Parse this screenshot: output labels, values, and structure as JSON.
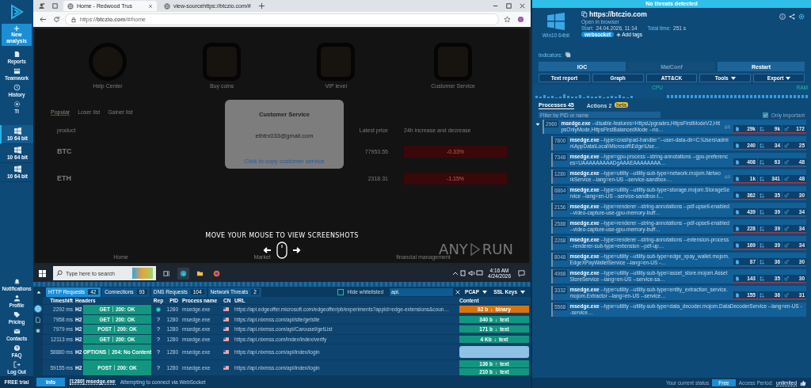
{
  "sidebar": {
    "new_analysis": "New analysis",
    "nav_top": [
      {
        "label": "Reports"
      },
      {
        "label": "Teamwork"
      },
      {
        "label": "History"
      },
      {
        "label": "TI"
      }
    ],
    "vms": [
      {
        "label": "10 64 bit",
        "selected": true
      },
      {
        "label": "10 64 bit",
        "selected": false
      },
      {
        "label": "10 64 bit",
        "selected": false
      }
    ],
    "nav_bottom": [
      {
        "label": "Notifications"
      },
      {
        "label": "Profile"
      },
      {
        "label": "Pricing"
      },
      {
        "label": "Contacts"
      },
      {
        "label": "FAQ"
      },
      {
        "label": "Log Out"
      }
    ],
    "trial_badge": "FREE trial"
  },
  "browser": {
    "tabs": [
      {
        "title": "Home - Redwood Trus",
        "selected": true
      },
      {
        "title": "view-sourcehttps://btczio.com/#",
        "selected": false
      }
    ],
    "address": "https://**btczio.com**/#/home"
  },
  "web": {
    "features": [
      "Help Center",
      "Buy coins",
      "VIP level",
      "Customer Service"
    ],
    "list_tabs": [
      {
        "label": "Popular",
        "selected": true
      },
      {
        "label": "Loser list",
        "selected": false
      },
      {
        "label": "Gainer list",
        "selected": false
      }
    ],
    "columns": [
      "product",
      "Latest price",
      "24h increase and decrease"
    ],
    "rows": [
      {
        "symbol": "BTC",
        "price": "77953.55",
        "change": "-0.33%"
      },
      {
        "symbol": "ETH",
        "price": "2318.31",
        "change": "-1.15%"
      }
    ],
    "nav": [
      "Home",
      "Market",
      "financial management"
    ],
    "modal": {
      "title": "Customer Service",
      "email": "ethtrx033@gmail.com",
      "link": "Click to copy customer service"
    },
    "hint": "MOVE YOUR MOUSE TO VIEW SCREENSHOTS",
    "logo": {
      "left": "ANY",
      "right": "RUN"
    }
  },
  "taskbar": {
    "search_placeholder": "Type here to search",
    "time": "4:16 AM",
    "date": "4/24/2026"
  },
  "network": {
    "tabs": [
      {
        "label": "HTTP Requests",
        "count": "42",
        "selected": true
      },
      {
        "label": "Connections",
        "count": "93",
        "selected": false
      },
      {
        "label": "DNS Requests",
        "count": "104",
        "selected": false
      },
      {
        "label": "Network Threats",
        "count": "2",
        "selected": false
      }
    ],
    "hide_whitelisted": {
      "label": "Hide whitelisted",
      "checked": false
    },
    "filter_value": "api.",
    "pcap": "PCAP",
    "ssl_keys": "SSL Keys",
    "columns": [
      "Timeshift",
      "Headers",
      "Rep",
      "PID",
      "Process name",
      "CN",
      "URL",
      "Content"
    ],
    "rows": [
      {
        "time": "2292 ms",
        "proto": "H2",
        "method": "GET",
        "status": "200: OK",
        "rep_ok": true,
        "pid": "1280",
        "process": "msedge.exe",
        "url": "https://api.edgeoffer.microsoft.com/edgeoffer/pb/experiments?appId=edge-extensions&coun…",
        "content": [
          {
            "size": "82 b",
            "arrow": "↓",
            "type": "binary",
            "color": "#d9730f"
          }
        ]
      },
      {
        "time": "7958 ms",
        "proto": "H2",
        "method": "GET",
        "status": "200: OK",
        "rep": "?",
        "pid": "1280",
        "process": "msedge.exe",
        "url": "https://api.nixmss.com/api/site/getsite",
        "content": [
          {
            "size": "340 b",
            "arrow": "↓",
            "type": "text",
            "color": "#13967f"
          }
        ]
      },
      {
        "time": "7979 ms",
        "proto": "H2",
        "method": "POST",
        "status": "200: OK",
        "rep": "?",
        "pid": "1280",
        "process": "msedge.exe",
        "url": "https://api.nixmss.com/api/Carousel/getList",
        "content": [
          {
            "size": "171 b",
            "arrow": "↓",
            "type": "text",
            "color": "#13967f"
          }
        ]
      },
      {
        "time": "12113 ms",
        "proto": "H2",
        "method": "GET",
        "status": "200: OK",
        "rep": "?",
        "pid": "1280",
        "process": "msedge.exe",
        "url": "https://api.nixmss.com/index/index/verify",
        "content": [
          {
            "size": "4 Kb",
            "arrow": "↓",
            "type": "text",
            "color": "#13967f"
          }
        ]
      },
      {
        "time": "58880 ms",
        "proto": "H2",
        "method": "OPTIONS",
        "status": "204: No Content",
        "rep": "?",
        "pid": "1280",
        "process": "msedge.exe",
        "url": "https://api.nixmss.com/api/index/login"
      },
      {
        "time": "59155 ms",
        "proto": "H2",
        "method": "POST",
        "status": "200: OK",
        "rep": "?",
        "pid": "1280",
        "process": "msedge.exe",
        "url": "https://api.nixmss.com/api/index/login",
        "content": [
          {
            "size": "136 b",
            "arrow": "↑",
            "type": "text",
            "color": "#13967f"
          },
          {
            "size": "210 b",
            "arrow": "↓",
            "type": "text",
            "color": "#13967f"
          }
        ]
      }
    ],
    "info": {
      "badge": "Info",
      "process": "[1280] msedge.exe",
      "message": "Attempting to connect via WebSocket"
    }
  },
  "analysis": {
    "banner": "No threats detected",
    "os": "Win10 64bit",
    "url": "https://btczio.com",
    "subtitle": "Open in browser",
    "start_label": "Start:",
    "start_value": "24.04.2026, 11:14",
    "total_label": "Total time:",
    "total_value": "251 s",
    "tags": [
      "websocket"
    ],
    "add_tags": "Add tags",
    "indicators_label": "Indicators:",
    "actions_row1": [
      {
        "label": "IOC",
        "disabled": false
      },
      {
        "label": "MalConf",
        "disabled": true
      },
      {
        "label": "Restart",
        "disabled": false
      }
    ],
    "actions_row2": [
      {
        "label": "Text report",
        "dropdown": false
      },
      {
        "label": "Graph",
        "dropdown": false
      },
      {
        "label": "ATT&CK",
        "dropdown": false
      },
      {
        "label": "Tools",
        "dropdown": true
      },
      {
        "label": "Export",
        "dropdown": true
      }
    ],
    "cpu_label": "CPU",
    "ram_label": "RAM",
    "tabs": [
      {
        "label": "Processes",
        "count": "45",
        "selected": true
      },
      {
        "label": "Actions",
        "count": "2",
        "selected": false,
        "badge": "beta"
      }
    ],
    "filter_placeholder": "Filter by PID or name",
    "only_important": {
      "label": "Only important",
      "checked": true
    },
    "root": {
      "pid": "2960",
      "name": "msedge.exe",
      "cmd": "--disable-features=HttpsUpgrades,HttpsFirstModeV2,HttpsOnlyMode,HttpsFirstBalancedMode --no…",
      "expanded": true,
      "network": true,
      "stats": [
        "29k",
        "9k",
        "172"
      ],
      "children": [
        {
          "pid": "7800",
          "name": "msedge.exe",
          "cmd": "--type=crashpad-handler \"--user-data-dir=C:\\Users\\admin\\AppData\\Local\\Microsoft\\Edge\\Use…",
          "stats": [
            "240",
            "34",
            "25"
          ]
        },
        {
          "pid": "7348",
          "name": "msedge.exe",
          "cmd": "--type=gpu-process --string-annotations --gpu-preferences=UAAAAAAAAADgAAAEAAAAAAAA…",
          "stats": [
            "408",
            "63",
            "48"
          ]
        },
        {
          "pid": "1280",
          "name": "msedge.exe",
          "cmd": "--type=utility --utility-sub-type=network.mojom.NetworkService --lang=en-US --service-sandbox-…",
          "network": true,
          "stats": [
            "1k",
            "341",
            "48"
          ]
        },
        {
          "pid": "6864",
          "name": "msedge.exe",
          "cmd": "--type=utility --utility-sub-type=storage.mojom.StorageService --lang=en-US --service-sandbox-t…",
          "stats": [
            "362",
            "35",
            "30"
          ]
        },
        {
          "pid": "2156",
          "name": "msedge.exe",
          "cmd": "--type=renderer --string-annotations --pdf-upsell-enabled --video-capture-use-gpu-memory-buff…",
          "stats": [
            "439",
            "39",
            "34"
          ]
        },
        {
          "pid": "2588",
          "name": "msedge.exe",
          "cmd": "--type=renderer --string-annotations --pdf-upsell-enabled --video-capture-use-gpu-memory-buff…",
          "stats": [
            "228",
            "39",
            "34"
          ]
        },
        {
          "pid": "2268",
          "name": "msedge.exe",
          "cmd": "--type=renderer --string-annotations --extension-process --renderer-sub-type=extension --pdf-up…",
          "stats": [
            "169",
            "39",
            "34"
          ]
        },
        {
          "pid": "8048",
          "name": "msedge.exe",
          "cmd": "--type=utility --utility-sub-type=edge_xpay_wallet.mojom.EdgeXPayWalletService --lang=en-US -…",
          "stats": [
            "87",
            "36",
            "30"
          ]
        },
        {
          "pid": "4968",
          "name": "msedge.exe",
          "cmd": "--type=utility --utility-sub-type=asset_store.mojom.AssetStoreService --lang=en-US --service-sa…",
          "stats": [
            "143",
            "35",
            "30"
          ]
        },
        {
          "pid": "3332",
          "name": "msedge.exe",
          "cmd": "--type=utility --utility-sub-type=entity_extraction_service.mojom.Extractor --lang=en-US --service…",
          "stats": [
            "155",
            "36",
            "31"
          ]
        },
        {
          "pid": "5568",
          "name": "msedge.exe",
          "cmd": "--type=utility --utility-sub-type=data_decoder.mojom.DataDecoderService --lang=en-US --service…"
        }
      ]
    },
    "status": {
      "label": "Your current status",
      "plan": "Free",
      "period_label": "Access Period:",
      "period_value": "unlimited"
    }
  }
}
